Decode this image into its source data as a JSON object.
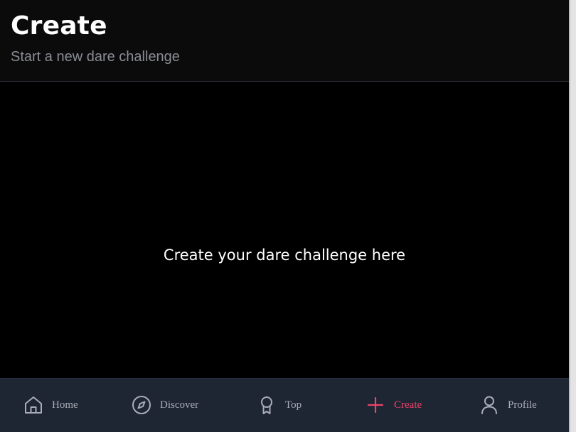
{
  "header": {
    "title": "Create",
    "subtitle": "Start a new dare challenge"
  },
  "main": {
    "placeholder": "Create your dare challenge here"
  },
  "nav": {
    "active": "Create",
    "items": [
      {
        "label": "Home",
        "icon": "home-icon"
      },
      {
        "label": "Discover",
        "icon": "compass-icon"
      },
      {
        "label": "Top",
        "icon": "award-icon"
      },
      {
        "label": "Create",
        "icon": "plus-icon"
      },
      {
        "label": "Profile",
        "icon": "user-icon"
      }
    ]
  },
  "colors": {
    "background": "#000000",
    "header_bg": "#0b0b0c",
    "nav_bg": "#1e2533",
    "accent": "#f0436a",
    "nav_text": "#a9adb7",
    "subtitle": "#8b8d94"
  }
}
